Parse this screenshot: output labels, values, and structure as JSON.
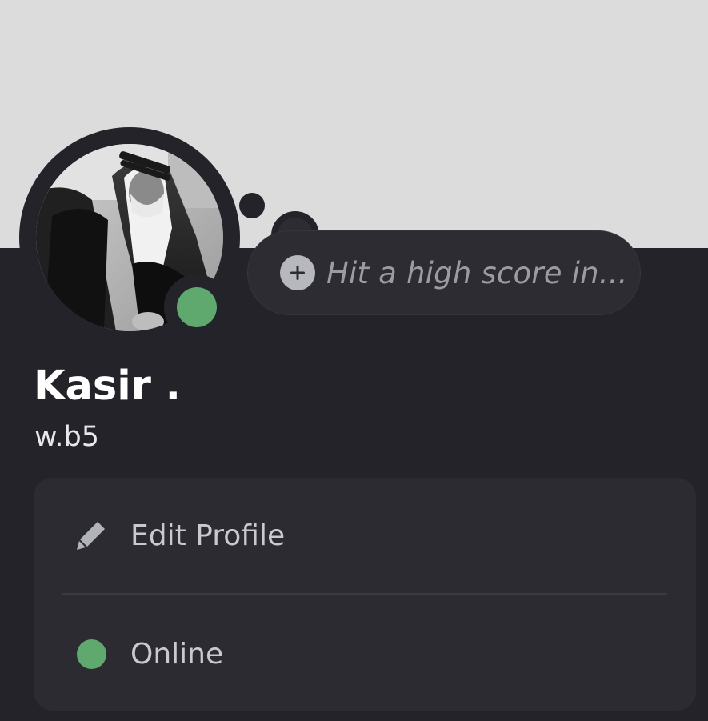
{
  "profile": {
    "display_name": "Kasir .",
    "username": "w.b5",
    "avatar_icon": "profile-photo",
    "status_indicator": "online",
    "status_color": "#5fa86e"
  },
  "custom_status": {
    "placeholder": "Hit a high score in...",
    "icon": "plus-circle-icon"
  },
  "menu": {
    "items": [
      {
        "label": "Edit Profile",
        "icon": "pencil-icon"
      },
      {
        "label": "Online",
        "icon": "online-status-dot-icon"
      }
    ]
  },
  "colors": {
    "banner": "#dcdcdc",
    "background": "#232329",
    "card": "#2b2b31",
    "online": "#5fa86e"
  }
}
